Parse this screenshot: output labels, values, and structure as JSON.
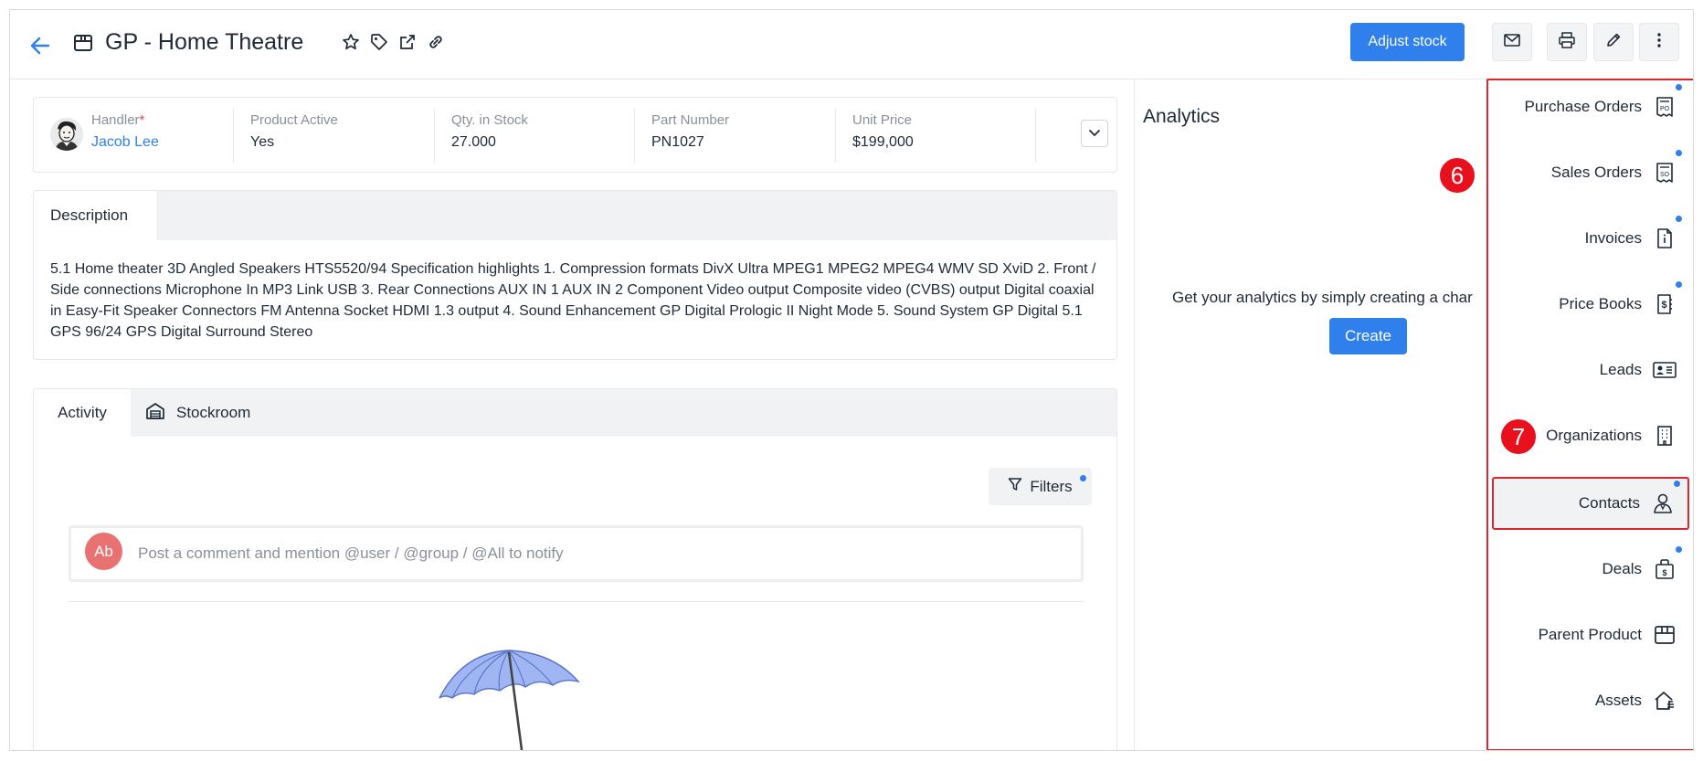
{
  "header": {
    "title": "GP - Home Theatre",
    "adjust_stock_label": "Adjust stock"
  },
  "summary": {
    "handler_label": "Handler",
    "handler_required": "*",
    "handler_value": "Jacob Lee",
    "product_active_label": "Product Active",
    "product_active_value": "Yes",
    "qty_label": "Qty. in Stock",
    "qty_value": "27.000",
    "part_number_label": "Part Number",
    "part_number_value": "PN1027",
    "unit_price_label": "Unit Price",
    "unit_price_value": "$199,000"
  },
  "description": {
    "tab_label": "Description",
    "text": "5.1 Home theater 3D Angled Speakers HTS5520/94 Specification highlights 1. Compression formats DivX Ultra MPEG1 MPEG2 MPEG4 WMV SD XviD 2. Front / Side connections Microphone In MP3 Link USB 3. Rear Connections AUX IN 1 AUX IN 2 Component Video output Composite video (CVBS) output Digital coaxial in Easy-Fit Speaker Connectors FM Antenna Socket HDMI 1.3 output 4. Sound Enhancement GP Digital Prologic II Night Mode 5. Sound System GP Digital 5.1 GPS 96/24 GPS Digital Surround Stereo"
  },
  "activity": {
    "tab_activity": "Activity",
    "tab_stockroom": "Stockroom",
    "filters_label": "Filters",
    "comment_avatar": "Ab",
    "comment_placeholder": "Post a comment and mention @user / @group / @All to notify"
  },
  "analytics": {
    "title": "Analytics",
    "message": "Get your analytics by simply creating a char",
    "create_label": "Create"
  },
  "side_panel": {
    "items": [
      {
        "label": "Purchase Orders",
        "icon": "purchase-order-icon"
      },
      {
        "label": "Sales Orders",
        "icon": "sales-order-icon"
      },
      {
        "label": "Invoices",
        "icon": "invoice-icon"
      },
      {
        "label": "Price Books",
        "icon": "price-book-icon"
      },
      {
        "label": "Leads",
        "icon": "lead-card-icon"
      },
      {
        "label": "Organizations",
        "icon": "building-icon"
      },
      {
        "label": "Contacts",
        "icon": "contact-icon"
      },
      {
        "label": "Deals",
        "icon": "deal-bag-icon"
      },
      {
        "label": "Parent Product",
        "icon": "box-icon"
      },
      {
        "label": "Assets",
        "icon": "house-icon"
      }
    ]
  },
  "callouts": {
    "six": "6",
    "seven": "7"
  },
  "colors": {
    "accent": "#2f80ed",
    "highlight": "#e0242f",
    "callout": "#e8101c"
  }
}
